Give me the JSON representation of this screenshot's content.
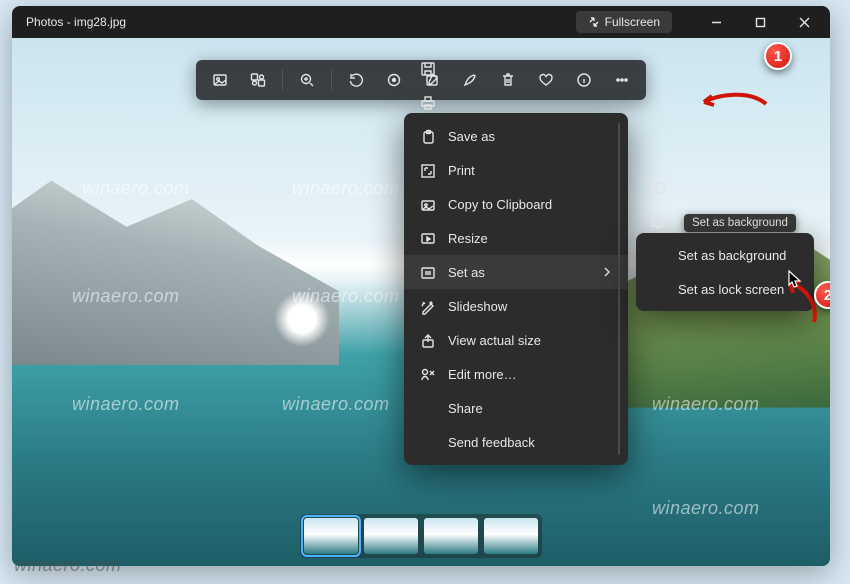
{
  "titlebar": {
    "app_name": "Photos",
    "filename": "img28.jpg",
    "fullscreen_label": "Fullscreen"
  },
  "toolbar": {
    "icons": [
      "image",
      "remix",
      "zoom-in",
      "rotate",
      "crop",
      "edit",
      "markup",
      "delete",
      "favorite",
      "info",
      "more"
    ]
  },
  "menu": {
    "items": [
      {
        "icon": "save",
        "label": "Save as"
      },
      {
        "icon": "print",
        "label": "Print"
      },
      {
        "icon": "clipboard",
        "label": "Copy to Clipboard"
      },
      {
        "icon": "resize",
        "label": "Resize"
      },
      {
        "icon": "setas",
        "label": "Set as",
        "submenu": true,
        "active": true
      },
      {
        "icon": "slideshow",
        "label": "Slideshow"
      },
      {
        "icon": "actual",
        "label": "View actual size"
      },
      {
        "icon": "editmore",
        "label": "Edit more…"
      },
      {
        "icon": "share",
        "label": "Share"
      },
      {
        "icon": "feedback",
        "label": "Send feedback"
      }
    ]
  },
  "submenu": {
    "items": [
      {
        "icon": "background",
        "label": "Set as background"
      },
      {
        "icon": "lockscreen",
        "label": "Set as lock screen"
      }
    ]
  },
  "tooltip": {
    "text": "Set as background"
  },
  "callouts": {
    "c1": "1",
    "c2": "2"
  },
  "watermark": "winaero.com",
  "filmstrip": {
    "count": 4,
    "selected": 0
  }
}
